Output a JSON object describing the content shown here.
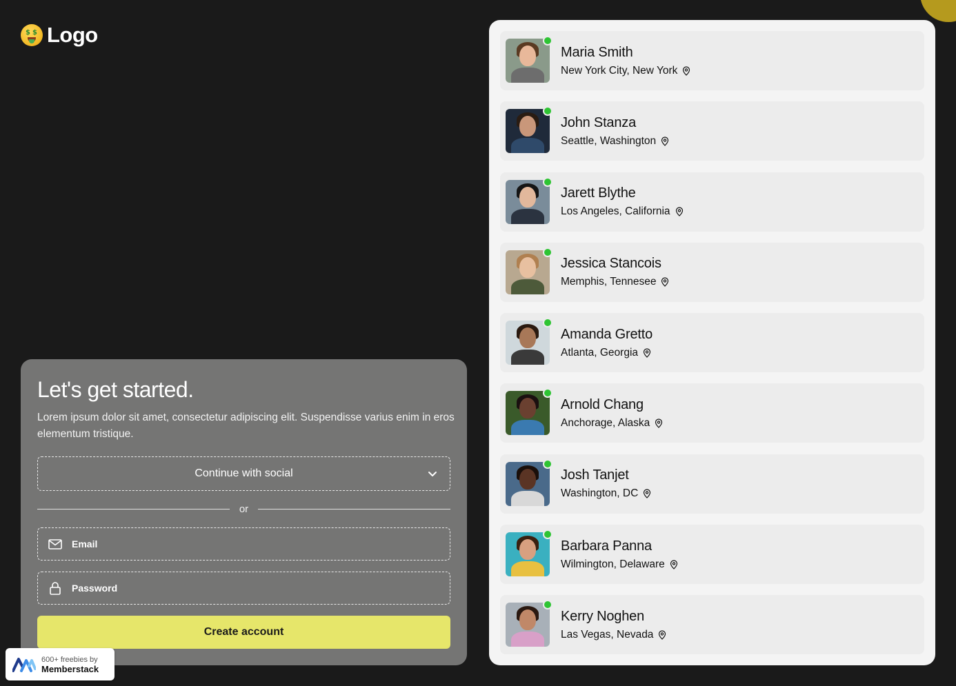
{
  "brand": {
    "logo_text": "Logo",
    "logo_icon": "money-mouth-face-icon"
  },
  "signup": {
    "title": "Let's get started.",
    "description": "Lorem ipsum dolor sit amet, consectetur adipiscing elit. Suspendisse varius enim in eros elementum tristique.",
    "social_label": "Continue with social",
    "divider_text": "or",
    "email_placeholder": "Email",
    "password_placeholder": "Password",
    "create_label": "Create account"
  },
  "badge": {
    "line1": "600+ freebies by",
    "line2": "Memberstack"
  },
  "people": [
    {
      "name": "Maria Smith",
      "location": "New York City, New York",
      "online": true,
      "bg": "#8a9a8a",
      "skin": "#e8b89a",
      "hair": "#5a3a22",
      "shirt": "#6d6d6d"
    },
    {
      "name": "John Stanza",
      "location": "Seattle, Washington",
      "online": true,
      "bg": "#1f2a3a",
      "skin": "#c9977a",
      "hair": "#2a1c12",
      "shirt": "#2f4a6a"
    },
    {
      "name": "Jarett Blythe",
      "location": "Los Angeles, California",
      "online": true,
      "bg": "#7a8c9a",
      "skin": "#e2b89c",
      "hair": "#151515",
      "shirt": "#2b3340"
    },
    {
      "name": "Jessica Stancois",
      "location": "Memphis, Tennesee",
      "online": true,
      "bg": "#b8a890",
      "skin": "#e8c0a0",
      "hair": "#b08050",
      "shirt": "#4d5a3a"
    },
    {
      "name": "Amanda Gretto",
      "location": "Atlanta, Georgia",
      "online": true,
      "bg": "#cfd8dc",
      "skin": "#a87858",
      "hair": "#2a1a10",
      "shirt": "#3a3a3a"
    },
    {
      "name": "Arnold Chang",
      "location": "Anchorage, Alaska",
      "online": true,
      "bg": "#3a5a2a",
      "skin": "#6a4030",
      "hair": "#1a1010",
      "shirt": "#3a7ab0"
    },
    {
      "name": "Josh Tanjet",
      "location": "Washington, DC",
      "online": true,
      "bg": "#4a6a8a",
      "skin": "#5a3424",
      "hair": "#1a0f0a",
      "shirt": "#d8d8d8"
    },
    {
      "name": "Barbara Panna",
      "location": "Wilmington, Delaware",
      "online": true,
      "bg": "#3ab0c0",
      "skin": "#d8a080",
      "hair": "#3a2010",
      "shirt": "#e8c040"
    },
    {
      "name": "Kerry Noghen",
      "location": "Las Vegas, Nevada",
      "online": true,
      "bg": "#a8b0b8",
      "skin": "#c08868",
      "hair": "#2a1810",
      "shirt": "#d8a0c8"
    }
  ]
}
